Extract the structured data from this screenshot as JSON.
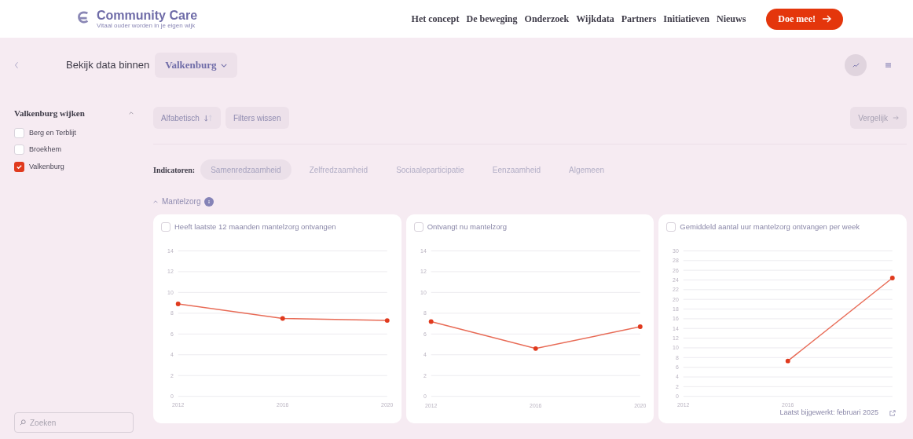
{
  "header": {
    "logo": {
      "title": "Community Care",
      "tagline": "Vitaal ouder worden in je eigen wijk"
    },
    "nav": [
      "Het concept",
      "De beweging",
      "Onderzoek",
      "Wijkdata",
      "Partners",
      "Initiatieven",
      "Nieuws"
    ],
    "cta": "Doe mee!"
  },
  "toolbar": {
    "label": "Bekijk data binnen",
    "location": "Valkenburg",
    "views": [
      {
        "kind": "chart",
        "selected": true
      },
      {
        "kind": "table",
        "selected": false
      }
    ]
  },
  "sidebar": {
    "title": "Valkenburg wijken",
    "expanded": true,
    "items": [
      {
        "label": "Berg en Terblijt",
        "checked": false
      },
      {
        "label": "Broekhem",
        "checked": false
      },
      {
        "label": "Valkenburg",
        "checked": true
      }
    ],
    "search": {
      "placeholder": "Zoeken"
    }
  },
  "filters": {
    "sort": "Alfabetisch",
    "clear": "Filters wissen",
    "compare": {
      "label": "Vergelijk",
      "disabled": true
    }
  },
  "indicators": {
    "label": "Indicatoren:",
    "tabs": [
      {
        "label": "Samenredzaamheid",
        "selected": true
      },
      {
        "label": "Zelfredzaamheid",
        "selected": false
      },
      {
        "label": "Sociaaleparticipatie",
        "selected": false
      },
      {
        "label": "Eenzaamheid",
        "selected": false
      },
      {
        "label": "Algemeen",
        "selected": false
      }
    ]
  },
  "section": {
    "title": "Mantelzorg",
    "expanded": true
  },
  "cards": [
    {
      "title": "Heeft laatste 12 maanden mantelzorg ontvangen",
      "checked": false,
      "chart_data": {
        "type": "line",
        "x": [
          2012,
          2016,
          2020
        ],
        "xlim": [
          2012,
          2020
        ],
        "xticks": [
          2012,
          2016,
          2020
        ],
        "ylim": [
          0,
          14
        ],
        "yticks": [
          0,
          2,
          4,
          6,
          8,
          10,
          12,
          14
        ],
        "grid": true,
        "series": [
          {
            "color": "#e03a1e",
            "marker": true,
            "values": [
              8.9,
              7.5,
              7.3
            ]
          }
        ]
      }
    },
    {
      "title": "Ontvangt nu mantelzorg",
      "checked": false,
      "chart_data": {
        "type": "line",
        "x": [
          2012,
          2016,
          2020
        ],
        "xlim": [
          2012,
          2020
        ],
        "xticks": [
          2012,
          2016,
          2020
        ],
        "ylim": [
          0,
          14
        ],
        "yticks": [
          0,
          2,
          4,
          6,
          8,
          10,
          12,
          14
        ],
        "grid": true,
        "series": [
          {
            "color": "#e03a1e",
            "marker": true,
            "values": [
              7.2,
              4.6,
              6.7
            ]
          }
        ]
      }
    },
    {
      "title": "Gemiddeld aantal uur mantelzorg ontvangen per week",
      "checked": false,
      "chart_data": {
        "type": "line",
        "x": [
          2016,
          2020
        ],
        "xlim": [
          2012,
          2020
        ],
        "xticks": [
          2012,
          2016
        ],
        "ylim": [
          0,
          30
        ],
        "yticks": [
          0,
          2,
          4,
          6,
          8,
          10,
          12,
          14,
          16,
          18,
          20,
          22,
          24,
          26,
          28,
          30
        ],
        "grid": true,
        "series": [
          {
            "color": "#e03a1e",
            "marker": true,
            "values": [
              7.3,
              24.4
            ]
          }
        ]
      }
    }
  ],
  "updated": "Laatst bijgewerkt: februari 2025"
}
